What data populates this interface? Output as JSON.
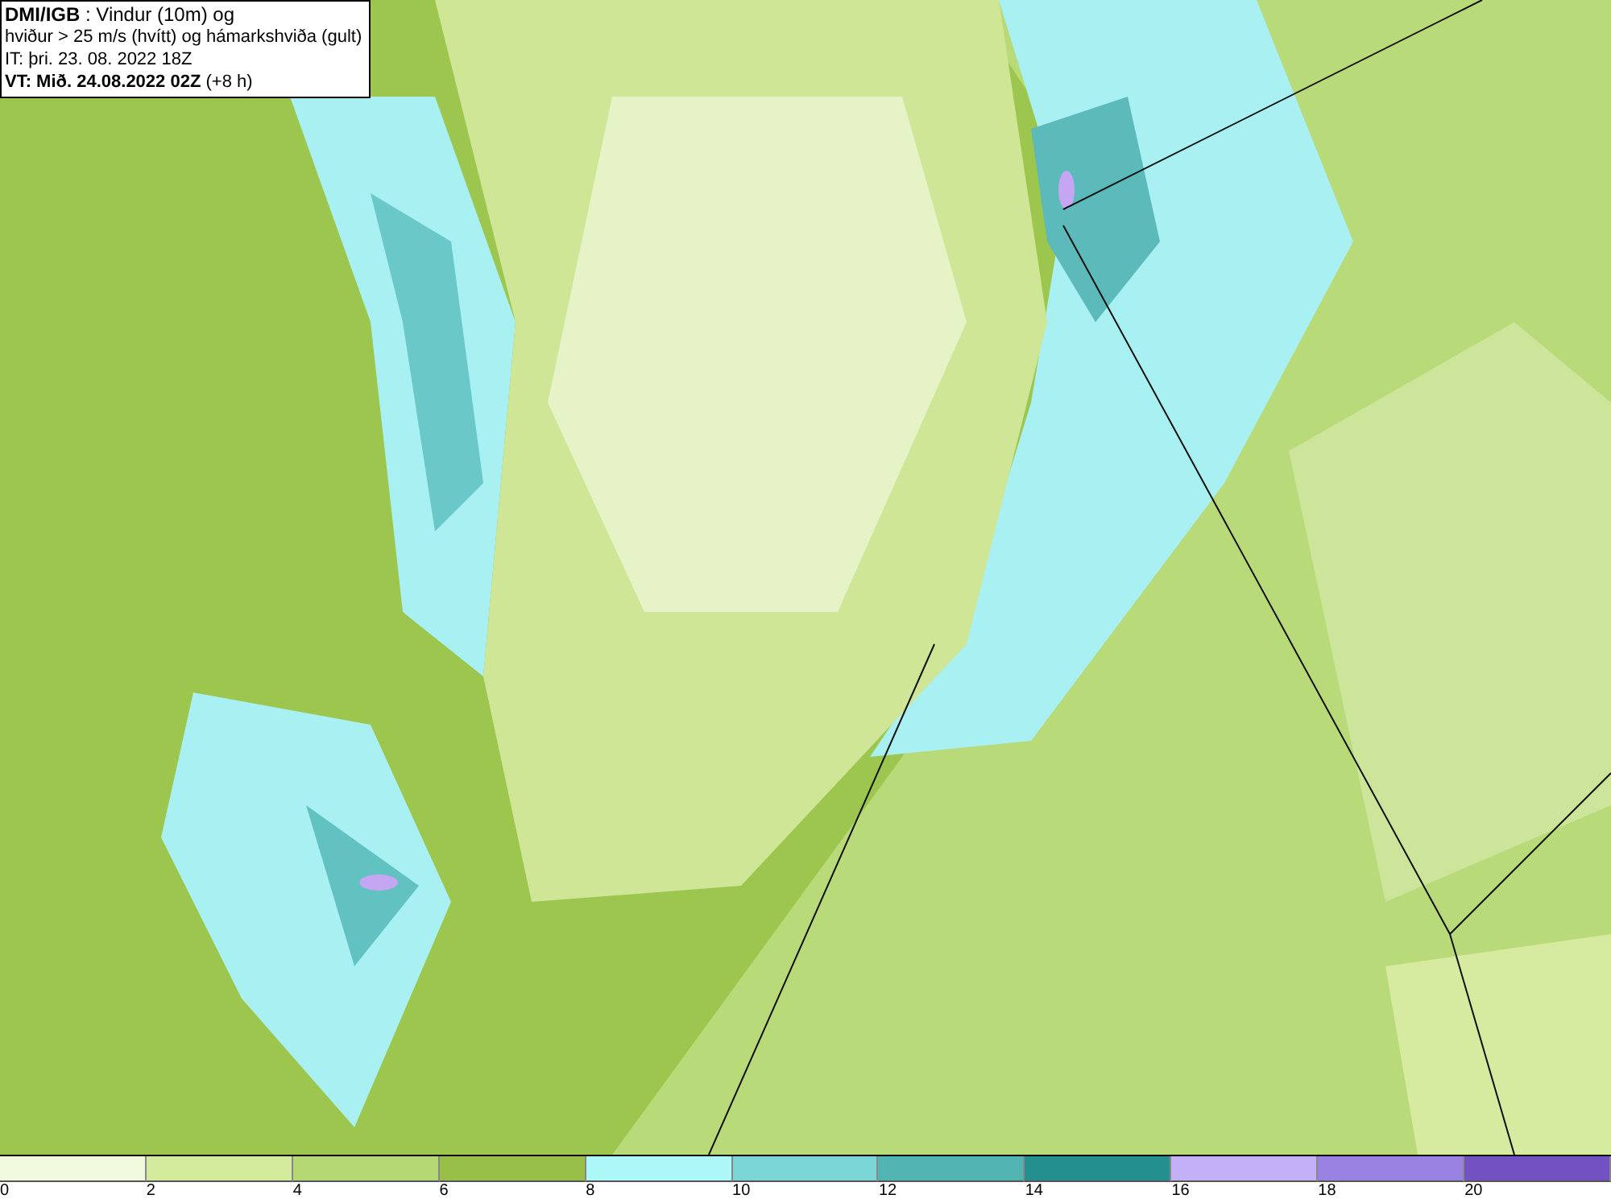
{
  "header": {
    "lines": [
      "**DMI/IGB** : Vindur (10m) og",
      "hviður > 25 m/s (hvítt) og hámarkshviða (gult)",
      "IT: þri. 23. 08. 2022 18Z",
      "**VT: Mið. 24.08.2022 02Z** (+8 h)"
    ]
  },
  "legend": {
    "bins": [
      {
        "label": "0",
        "color": "#f1f9de"
      },
      {
        "label": "2",
        "color": "#d4ea9c"
      },
      {
        "label": "4",
        "color": "#b6d874"
      },
      {
        "label": "6",
        "color": "#98c048"
      },
      {
        "label": "8",
        "color": "#acf7f7"
      },
      {
        "label": "10",
        "color": "#7ad6d6"
      },
      {
        "label": "12",
        "color": "#52b3b3"
      },
      {
        "label": "14",
        "color": "#248f8f"
      },
      {
        "label": "16",
        "color": "#c3b0f7"
      },
      {
        "label": "18",
        "color": "#9a82e2"
      },
      {
        "label": "20",
        "color": "#7252c2"
      }
    ]
  }
}
